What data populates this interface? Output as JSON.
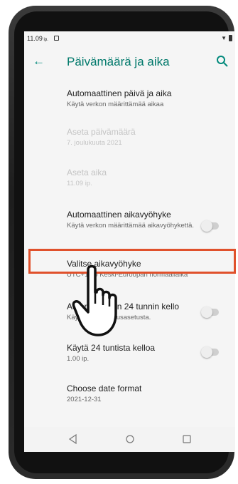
{
  "status": {
    "time": "11.09",
    "time_suffix": "ip."
  },
  "appbar": {
    "title": "Päivämäärä ja aika"
  },
  "settings": [
    {
      "title": "Automaattinen päivä ja aika",
      "subtitle": "Käytä verkon määrittämää aikaa",
      "enabled": true
    },
    {
      "title": "Aseta päivämäärä",
      "subtitle": "7. joulukuuta 2021",
      "enabled": false
    },
    {
      "title": "Aseta aika",
      "subtitle": "11.09 ip.",
      "enabled": false
    },
    {
      "title": "Automaattinen aikavyöhyke",
      "subtitle": "Käytä verkon määrittämää aikavyöhykettä.",
      "toggle": "off"
    },
    {
      "title": "Valitse aikavyöhyke",
      "subtitle": "UTC+1.00 Keski-Euroopan normaaliaika"
    },
    {
      "title": "Automaattinen 24 tunnin kello",
      "subtitle": "Käytä kielen oletusasetusta.",
      "toggle": "off"
    },
    {
      "title": "Käytä 24 tuntista kelloa",
      "subtitle": "1.00 ip.",
      "toggle": "off"
    },
    {
      "title": "Choose date format",
      "subtitle": "2021-12-31"
    }
  ],
  "colors": {
    "accent": "#00897b",
    "highlight": "#e0512c"
  },
  "icons": {
    "back": "arrow-left-icon",
    "search": "search-icon",
    "nav_back": "triangle-back-icon",
    "nav_home": "circle-home-icon",
    "nav_recents": "square-recents-icon",
    "pointer": "hand-pointer-icon"
  }
}
